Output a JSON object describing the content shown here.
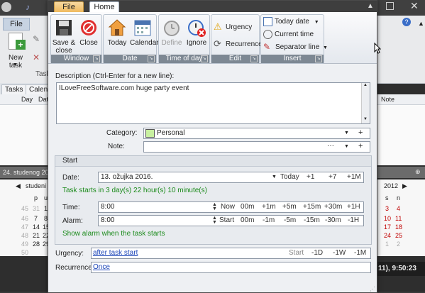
{
  "background": {
    "ribbon": {
      "file_tab": "File",
      "new_task_label": "New task",
      "tasks_tab_short": "Task"
    },
    "tabs": [
      "Tasks",
      "Calend"
    ],
    "list_columns": [
      "Day",
      "Dat"
    ],
    "right_list_column": "Note",
    "date_strip": "24. studenog 20",
    "month_left": "studeni",
    "month_right": "2012",
    "weekday_headers_left": [
      "p",
      "u"
    ],
    "weekday_headers_right": [
      "s",
      "n"
    ],
    "week_numbers": [
      "45",
      "46",
      "47",
      "48",
      "49",
      "50"
    ],
    "left_days": [
      [
        "31",
        "1"
      ],
      [
        "7",
        "8"
      ],
      [
        "14",
        "15"
      ],
      [
        "21",
        "22"
      ],
      [
        "28",
        "29"
      ]
    ],
    "right_days": [
      [
        "3",
        "4"
      ],
      [
        "10",
        "11"
      ],
      [
        "17",
        "18"
      ],
      [
        "24",
        "25"
      ],
      [
        "1",
        "2"
      ]
    ],
    "status_time": "11), 9:50:23"
  },
  "dialog": {
    "tabs": {
      "file": "File",
      "home": "Home"
    },
    "ribbon": {
      "window": {
        "label": "Window",
        "save_close": "Save &\nclose",
        "close": "Close"
      },
      "date": {
        "label": "Date",
        "today": "Today",
        "calendar": "Calendar"
      },
      "time_of_day": {
        "label": "Time of day",
        "define": "Define",
        "ignore": "Ignore"
      },
      "edit": {
        "label": "Edit",
        "urgency": "Urgency",
        "recurrence": "Recurrence"
      },
      "insert": {
        "label": "Insert",
        "today_date": "Today date",
        "current_time": "Current time",
        "separator_line": "Separator line"
      }
    },
    "description_label": "Description (Ctrl-Enter for a new line):",
    "description_value": "ILoveFreeSoftware.com huge party event",
    "category_label": "Category:",
    "category_value": "Personal",
    "category_color": "#c8f0a0",
    "note_label": "Note:",
    "note_value": "",
    "start_section": {
      "title": "Start",
      "date_label": "Date:",
      "date_value": "13. ožujka 2016.",
      "date_quick": [
        "Today",
        "+1",
        "+7",
        "+1M"
      ],
      "starts_in": "Task starts in 3 day(s) 22 hour(s) 10 minute(s)",
      "time_label": "Time:",
      "time_value": "8:00",
      "time_quick": [
        "Now",
        "00m",
        "+1m",
        "+5m",
        "+15m",
        "+30m",
        "+1H"
      ],
      "alarm_label": "Alarm:",
      "alarm_value": "8:00",
      "alarm_quick": [
        "Start",
        "00m",
        "-1m",
        "-5m",
        "-15m",
        "-30m",
        "-1H"
      ],
      "show_alarm": "Show alarm when the task starts"
    },
    "urgency_label": "Urgency:",
    "urgency_value": "after task start",
    "urgency_quick": [
      "Start",
      "-1D",
      "-1W",
      "-1M"
    ],
    "recurrence_label": "Recurrence:",
    "recurrence_value": "Once",
    "colors": {
      "accent_orange": "#efb85a",
      "green_text": "#1a8a1a",
      "link": "#1a44b8",
      "alarm_red": "#c00000"
    }
  }
}
